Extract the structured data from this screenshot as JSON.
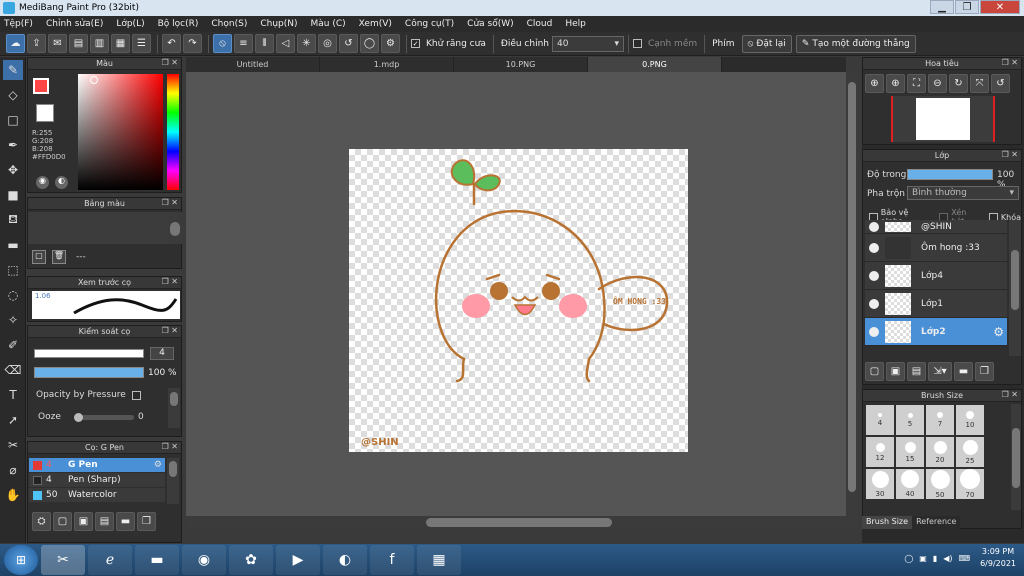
{
  "window": {
    "title": "MediBang Paint Pro (32bit)"
  },
  "menu": [
    "Tệp(F)",
    "Chỉnh sửa(E)",
    "Lớp(L)",
    "Bộ lọc(R)",
    "Chọn(S)",
    "Chụp(N)",
    "Màu (C)",
    "Xem(V)",
    "Công cụ(T)",
    "Cửa sổ(W)",
    "Cloud",
    "Help"
  ],
  "toolbar": {
    "antialias_label": "Khử răng cưa",
    "correction_label": "Điều chỉnh",
    "correction_value": "40",
    "soft_edge_label": "Cạnh mềm",
    "prime_label": "Phím",
    "reset_label": "Đặt lại",
    "straight_line_label": "Tạo một đường thẳng"
  },
  "color_panel": {
    "title": "Màu",
    "r": "R:255",
    "g": "G:208",
    "b": "B:208",
    "hex": "#FFD0D0",
    "primary": "#ff4646",
    "secondary": "#ffffff"
  },
  "palette_panel": {
    "title": "Bảng màu",
    "value": "---"
  },
  "brush_preview": {
    "title": "Xem trước cọ",
    "size": "1.06"
  },
  "brush_control": {
    "title": "Kiểm soát cọ",
    "size": "4",
    "opacity": "100 %",
    "pressure_label": "Opacity by Pressure",
    "ooze_label": "Ooze",
    "ooze_value": "0"
  },
  "brush_list": {
    "title": "Cọ: G Pen",
    "items": [
      {
        "size": "4",
        "name": "G Pen",
        "color": "#e53935"
      },
      {
        "size": "4",
        "name": "Pen (Sharp)",
        "color": "#222222"
      },
      {
        "size": "50",
        "name": "Watercolor",
        "color": "#4fc3f7"
      }
    ]
  },
  "tabs": [
    "Untitled",
    "1.mdp",
    "10.PNG",
    "0.PNG"
  ],
  "canvas": {
    "speech_text": "ÔM HONG :33",
    "signature": "@SHIN"
  },
  "navigator": {
    "title": "Hoa tiêu"
  },
  "layer_panel": {
    "title": "Lớp",
    "opacity_label": "Độ trong",
    "opacity_value": "100 %",
    "blend_label": "Pha trộn",
    "blend_value": "Bình thường",
    "protect_alpha": "Bảo vệ alpha",
    "clipping": "Xén bớt",
    "lock": "Khóa",
    "layers": [
      "@SHIN",
      "Ôm hong :33",
      "Lớp4",
      "Lớp1",
      "Lớp2"
    ]
  },
  "brush_size": {
    "title": "Brush Size",
    "sizes": [
      "4",
      "5",
      "7",
      "10",
      "12",
      "15",
      "20",
      "25",
      "30",
      "40",
      "50",
      "70"
    ],
    "tabs": [
      "Brush Size",
      "Reference"
    ]
  },
  "taskbar": {
    "time": "3:09 PM",
    "date": "6/9/2021"
  }
}
